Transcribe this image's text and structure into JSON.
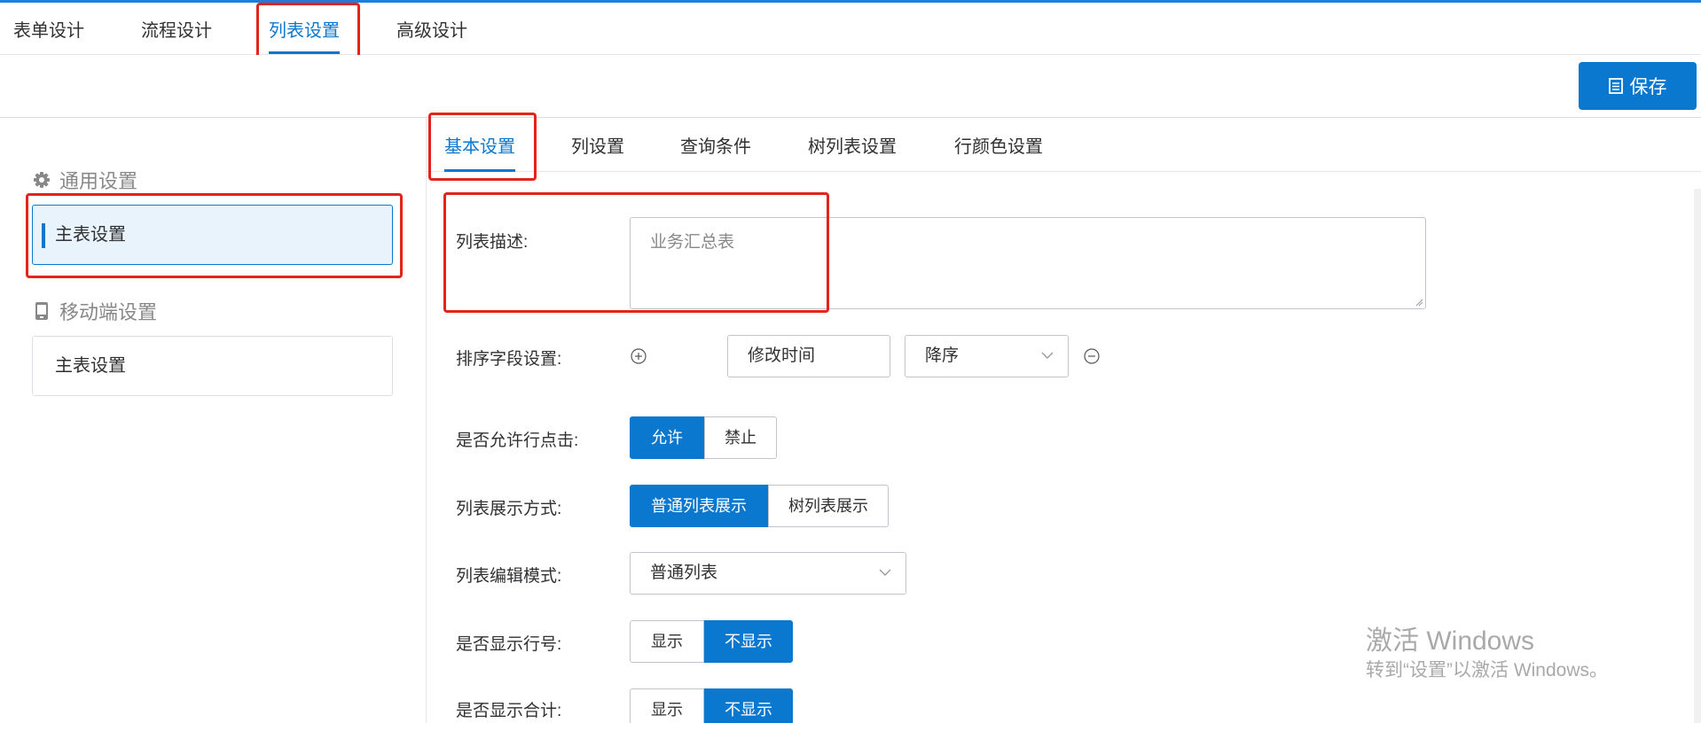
{
  "top_tabs": [
    "表单设计",
    "流程设计",
    "列表设置",
    "高级设计"
  ],
  "toolbar": {
    "save_label": "保存",
    "save_icon": "document-icon"
  },
  "sidebar": {
    "general_title": "通用设置",
    "general_icon": "gear-icon",
    "general_item": "主表设置",
    "mobile_title": "移动端设置",
    "mobile_icon": "mobile-icon",
    "mobile_item": "主表设置"
  },
  "sub_tabs": [
    "基本设置",
    "列设置",
    "查询条件",
    "树列表设置",
    "行颜色设置"
  ],
  "form": {
    "description": {
      "label": "列表描述:",
      "value": "业务汇总表"
    },
    "sort": {
      "label": "排序字段设置:",
      "field": "修改时间",
      "order": "降序"
    },
    "row_click": {
      "label": "是否允许行点击:",
      "options": [
        "允许",
        "禁止"
      ],
      "selected": "允许"
    },
    "display_mode": {
      "label": "列表展示方式:",
      "options": [
        "普通列表展示",
        "树列表展示"
      ],
      "selected": "普通列表展示"
    },
    "edit_mode": {
      "label": "列表编辑模式:",
      "value": "普通列表"
    },
    "row_number": {
      "label": "是否显示行号:",
      "options": [
        "显示",
        "不显示"
      ],
      "selected": "不显示"
    },
    "total": {
      "label": "是否显示合计:",
      "options": [
        "显示",
        "不显示"
      ],
      "selected": "不显示"
    }
  },
  "watermark": {
    "title": "激活 Windows",
    "subtitle": "转到“设置”以激活 Windows。"
  },
  "colors": {
    "accent": "#0b78d0",
    "highlight": "#e5231b"
  }
}
